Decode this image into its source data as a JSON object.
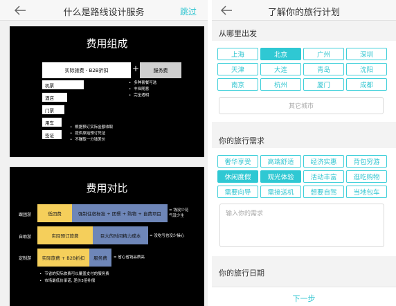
{
  "left": {
    "title": "什么是路线设计服务",
    "skip": "跳过",
    "slide1": {
      "title": "费用组成",
      "actual": "实际旅费 - B2B折扣",
      "plus": "+",
      "service": "服务费",
      "items": [
        "机票",
        "酒店",
        "门票",
        "用车",
        "签证"
      ],
      "service_points": [
        "多种套餐可选",
        "丰俭随意",
        "完全透明"
      ],
      "actual_points": [
        "根据预订实际金额收取",
        "提供原始预订凭证",
        "不赚取一分钱差价"
      ]
    },
    "slide2": {
      "title": "费用对比",
      "rows": [
        {
          "label": "跟团游",
          "bar1": "低团费",
          "bar2": "强制住宿标准 + 团餐 + 购物 + 自费项目",
          "result": [
            "= 钱没少花",
            "气没少生"
          ]
        },
        {
          "label": "自助游",
          "bar1": "实际预订旅费",
          "bar2": "巨大的时间精力成本",
          "result": [
            "= 没吃亏也没少操心"
          ]
        },
        {
          "label": "定制游",
          "bar1": "实际旅费 + B2B折扣",
          "bar2": "服务费",
          "result": [
            "= 省心省钱品质高"
          ]
        }
      ],
      "footnotes": [
        "节省的实际旅费可以覆盖支付的服务费",
        "市场最低价承诺, 差价3倍补偿"
      ]
    }
  },
  "right": {
    "title": "了解你的旅行计划",
    "from_label": "从哪里出发",
    "cities": [
      {
        "name": "上海",
        "selected": false
      },
      {
        "name": "北京",
        "selected": true
      },
      {
        "name": "广州",
        "selected": false
      },
      {
        "name": "深圳",
        "selected": false
      },
      {
        "name": "天津",
        "selected": false
      },
      {
        "name": "大连",
        "selected": false
      },
      {
        "name": "青岛",
        "selected": false
      },
      {
        "name": "沈阳",
        "selected": false
      },
      {
        "name": "南京",
        "selected": false
      },
      {
        "name": "杭州",
        "selected": false
      },
      {
        "name": "厦门",
        "selected": false
      },
      {
        "name": "成都",
        "selected": false
      }
    ],
    "other_city": "其它城市",
    "needs_label": "你的旅行需求",
    "needs": [
      {
        "name": "奢华享受",
        "selected": false
      },
      {
        "name": "高端舒适",
        "selected": false
      },
      {
        "name": "经济实惠",
        "selected": false
      },
      {
        "name": "背包穷游",
        "selected": false
      },
      {
        "name": "休闲度假",
        "selected": true
      },
      {
        "name": "观光体验",
        "selected": true
      },
      {
        "name": "活动丰富",
        "selected": false
      },
      {
        "name": "逛吃购物",
        "selected": false
      },
      {
        "name": "需要向导",
        "selected": false
      },
      {
        "name": "需接送机",
        "selected": false
      },
      {
        "name": "想要自驾",
        "selected": false
      },
      {
        "name": "当地包车",
        "selected": false
      }
    ],
    "needs_placeholder": "输入你的需求",
    "date_label": "你的旅行日期",
    "next": "下一步"
  },
  "colors": {
    "accent": "#2fc8d3",
    "yellow_bar": "#f5cf5b",
    "blue_bar": "#6e86b8"
  }
}
